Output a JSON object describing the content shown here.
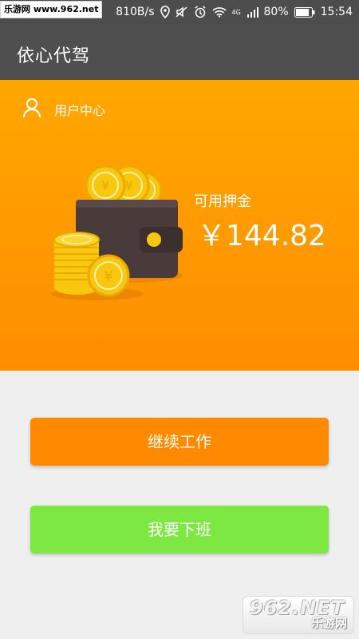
{
  "status_bar": {
    "watermark": "乐游网 www.962.net",
    "net_speed": "810B/s",
    "network": "4G",
    "battery": "80%",
    "time": "15:54"
  },
  "app_bar": {
    "title": "依心代驾"
  },
  "user_center": {
    "label": "用户中心"
  },
  "deposit": {
    "label": "可用押金",
    "amount": "￥144.82"
  },
  "buttons": {
    "continue_label": "继续工作",
    "off_duty_label": "我要下班"
  },
  "watermark_bottom": {
    "brand": "962.NET",
    "text": "乐游网"
  },
  "colors": {
    "hero_bg": "#ff9800",
    "continue_button": "#ff8a00",
    "off_duty_button": "#7ee842",
    "app_bar": "#4f4f4f",
    "coin": "#f9c80e",
    "wallet": "#4a3b3b"
  }
}
